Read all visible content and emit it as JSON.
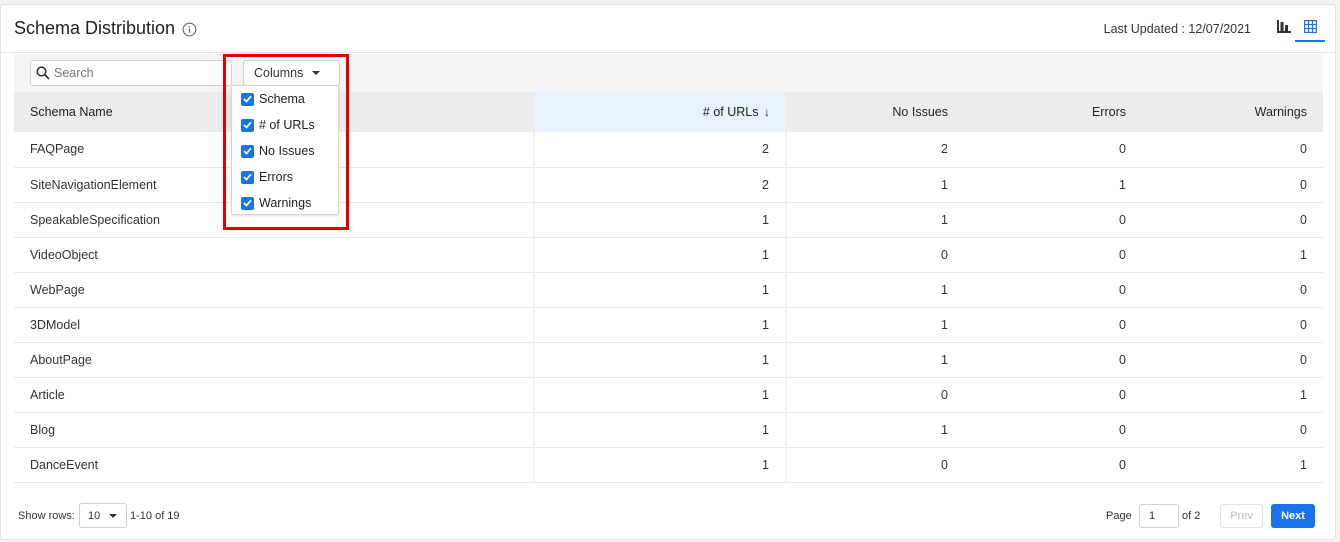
{
  "header": {
    "title": "Schema Distribution",
    "last_updated": "Last Updated : 12/07/2021"
  },
  "toolbar": {
    "search_placeholder": "Search",
    "columns_label": "Columns"
  },
  "columns_menu": {
    "options": [
      {
        "label": "Schema",
        "checked": true
      },
      {
        "label": "# of URLs",
        "checked": true
      },
      {
        "label": "No Issues",
        "checked": true
      },
      {
        "label": "Errors",
        "checked": true
      },
      {
        "label": "Warnings",
        "checked": true
      }
    ]
  },
  "table": {
    "headers": [
      "Schema Name",
      "# of URLs",
      "No Issues",
      "Errors",
      "Warnings"
    ],
    "sort_indicator": "↓",
    "rows": [
      [
        "FAQPage",
        "2",
        "2",
        "0",
        "0"
      ],
      [
        "SiteNavigationElement",
        "2",
        "1",
        "1",
        "0"
      ],
      [
        "SpeakableSpecification",
        "1",
        "1",
        "0",
        "0"
      ],
      [
        "VideoObject",
        "1",
        "0",
        "0",
        "1"
      ],
      [
        "WebPage",
        "1",
        "1",
        "0",
        "0"
      ],
      [
        "3DModel",
        "1",
        "1",
        "0",
        "0"
      ],
      [
        "AboutPage",
        "1",
        "1",
        "0",
        "0"
      ],
      [
        "Article",
        "1",
        "0",
        "0",
        "1"
      ],
      [
        "Blog",
        "1",
        "1",
        "0",
        "0"
      ],
      [
        "DanceEvent",
        "1",
        "0",
        "0",
        "1"
      ]
    ]
  },
  "footer": {
    "show_rows_label": "Show rows:",
    "rows_value": "10",
    "range": "1-10 of 19",
    "page_label": "Page",
    "page_value": "1",
    "of_pages": "of 2",
    "prev_label": "Prev",
    "next_label": "Next"
  },
  "colors": {
    "accent": "#1a73e8",
    "highlight_box": "#e00000",
    "sorted_column_bg": "#e9f1fd"
  }
}
